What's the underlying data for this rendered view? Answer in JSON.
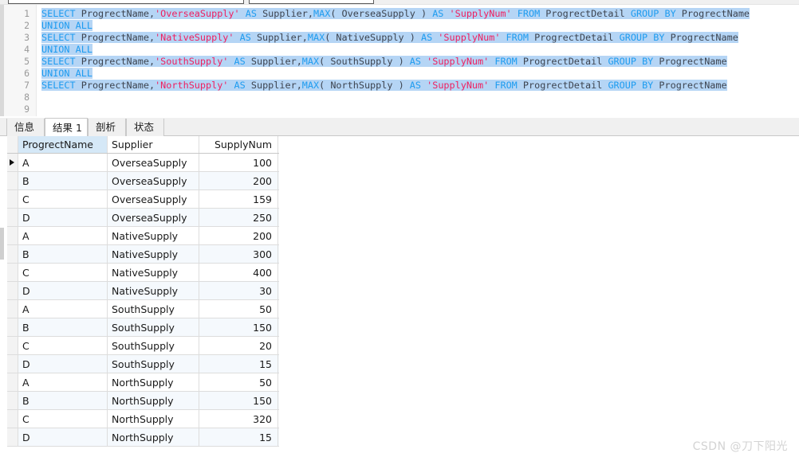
{
  "toolbar": {
    "fields": [
      {
        "name": "toolbar-field-1",
        "value": "",
        "placeholder": ""
      },
      {
        "name": "toolbar-field-2",
        "value": "",
        "placeholder": ""
      }
    ]
  },
  "editor": {
    "line_numbers": [
      "1",
      "2",
      "3",
      "4",
      "5",
      "6",
      "7",
      "8",
      "9"
    ],
    "selection_color": "#b5d5f5",
    "keyword_color": "#1e9cf0",
    "string_color": "#ef2060",
    "identifier_color": "#3d4450",
    "lines": [
      {
        "number": "1",
        "selected": true,
        "text": "SELECT ProgrectName,'OverseaSupply' AS Supplier,MAX( OverseaSupply ) AS 'SupplyNum' FROM ProgrectDetail GROUP BY ProgrectName"
      },
      {
        "number": "2",
        "selected": true,
        "text": "UNION ALL"
      },
      {
        "number": "3",
        "selected": true,
        "text": "SELECT ProgrectName,'NativeSupply' AS Supplier,MAX( NativeSupply ) AS 'SupplyNum' FROM ProgrectDetail GROUP BY ProgrectName"
      },
      {
        "number": "4",
        "selected": true,
        "text": "UNION ALL"
      },
      {
        "number": "5",
        "selected": true,
        "text": "SELECT ProgrectName,'SouthSupply' AS Supplier,MAX( SouthSupply ) AS 'SupplyNum' FROM ProgrectDetail GROUP BY ProgrectName"
      },
      {
        "number": "6",
        "selected": true,
        "text": "UNION ALL"
      },
      {
        "number": "7",
        "selected": true,
        "text": "SELECT ProgrectName,'NorthSupply' AS Supplier,MAX( NorthSupply ) AS 'SupplyNum' FROM ProgrectDetail GROUP BY ProgrectName"
      },
      {
        "number": "8",
        "selected": false,
        "text": ""
      },
      {
        "number": "9",
        "selected": false,
        "text": ""
      }
    ]
  },
  "tabs": [
    {
      "label": "信息",
      "active": false
    },
    {
      "label": "结果 1",
      "active": true
    },
    {
      "label": "剖析",
      "active": false
    },
    {
      "label": "状态",
      "active": false
    }
  ],
  "result_grid": {
    "columns": [
      "ProgrectName",
      "Supplier",
      "SupplyNum"
    ],
    "selected_column": "ProgrectName",
    "current_row_index": 0,
    "rows": [
      {
        "ProgrectName": "A",
        "Supplier": "OverseaSupply",
        "SupplyNum": "100"
      },
      {
        "ProgrectName": "B",
        "Supplier": "OverseaSupply",
        "SupplyNum": "200"
      },
      {
        "ProgrectName": "C",
        "Supplier": "OverseaSupply",
        "SupplyNum": "159"
      },
      {
        "ProgrectName": "D",
        "Supplier": "OverseaSupply",
        "SupplyNum": "250"
      },
      {
        "ProgrectName": "A",
        "Supplier": "NativeSupply",
        "SupplyNum": "200"
      },
      {
        "ProgrectName": "B",
        "Supplier": "NativeSupply",
        "SupplyNum": "300"
      },
      {
        "ProgrectName": "C",
        "Supplier": "NativeSupply",
        "SupplyNum": "400"
      },
      {
        "ProgrectName": "D",
        "Supplier": "NativeSupply",
        "SupplyNum": "30"
      },
      {
        "ProgrectName": "A",
        "Supplier": "SouthSupply",
        "SupplyNum": "50"
      },
      {
        "ProgrectName": "B",
        "Supplier": "SouthSupply",
        "SupplyNum": "150"
      },
      {
        "ProgrectName": "C",
        "Supplier": "SouthSupply",
        "SupplyNum": "20"
      },
      {
        "ProgrectName": "D",
        "Supplier": "SouthSupply",
        "SupplyNum": "15"
      },
      {
        "ProgrectName": "A",
        "Supplier": "NorthSupply",
        "SupplyNum": "50"
      },
      {
        "ProgrectName": "B",
        "Supplier": "NorthSupply",
        "SupplyNum": "150"
      },
      {
        "ProgrectName": "C",
        "Supplier": "NorthSupply",
        "SupplyNum": "320"
      },
      {
        "ProgrectName": "D",
        "Supplier": "NorthSupply",
        "SupplyNum": "15"
      }
    ]
  },
  "watermark": {
    "text": "CSDN @刀下阳光"
  }
}
